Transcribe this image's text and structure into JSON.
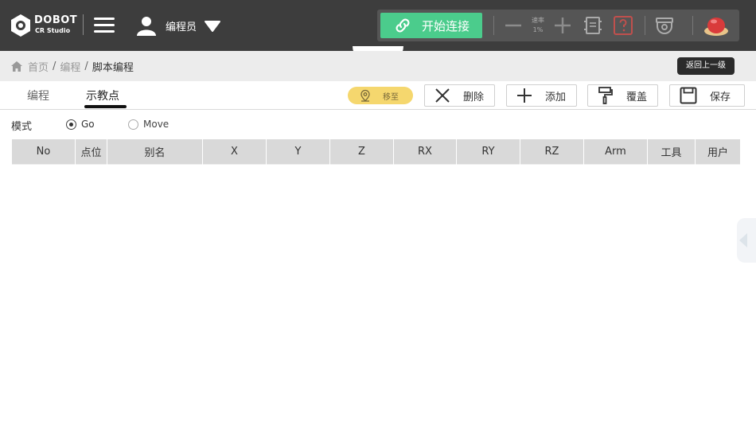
{
  "header": {
    "logo": {
      "brand": "DOBOT",
      "product": "CR Studio"
    },
    "user": {
      "name": "编程员"
    },
    "connect_label": "开始连接",
    "speed": {
      "label": "速率",
      "value": "1%"
    }
  },
  "breadcrumb": {
    "home": "首页",
    "program": "编程",
    "current": "脚本编程"
  },
  "back_label": "返回上一级",
  "tabs": [
    {
      "label": "编程",
      "active": false
    },
    {
      "label": "示教点",
      "active": true
    }
  ],
  "actions": {
    "move_to": "移至",
    "delete": "删除",
    "add": "添加",
    "overwrite": "覆盖",
    "save": "保存"
  },
  "mode": {
    "label": "模式",
    "options": [
      {
        "label": "Go",
        "checked": true
      },
      {
        "label": "Move",
        "checked": false
      }
    ]
  },
  "table": {
    "columns": [
      "No",
      "点位",
      "别名",
      "X",
      "Y",
      "Z",
      "RX",
      "RY",
      "RZ",
      "Arm",
      "工具",
      "用户"
    ],
    "rows": []
  },
  "colors": {
    "topbar": "#3d3d3d",
    "connect_green": "#4bcc8c",
    "moveto_yellow": "#f5d76e",
    "header_cell": "#d9d9d9"
  }
}
